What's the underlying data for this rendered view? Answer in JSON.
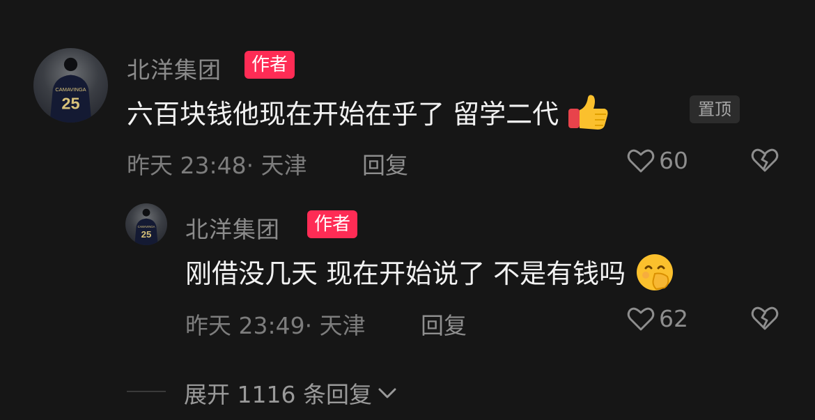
{
  "comments": [
    {
      "username": "北洋集团",
      "badge": "作者",
      "text": "六百块钱他现在开始在乎了 留学二代",
      "emoji": "thumbs-up",
      "pin_label": "置顶",
      "meta": "昨天 23:48· 天津",
      "reply_label": "回复",
      "likes": "60"
    },
    {
      "username": "北洋集团",
      "badge": "作者",
      "text": "刚借没几天 现在开始说了 不是有钱吗",
      "emoji": "hand-over-mouth",
      "meta": "昨天 23:49· 天津",
      "reply_label": "回复",
      "likes": "62"
    }
  ],
  "expand_label": "展开 1116 条回复",
  "colors": {
    "badge": "#fe2c55",
    "background": "#161616"
  }
}
